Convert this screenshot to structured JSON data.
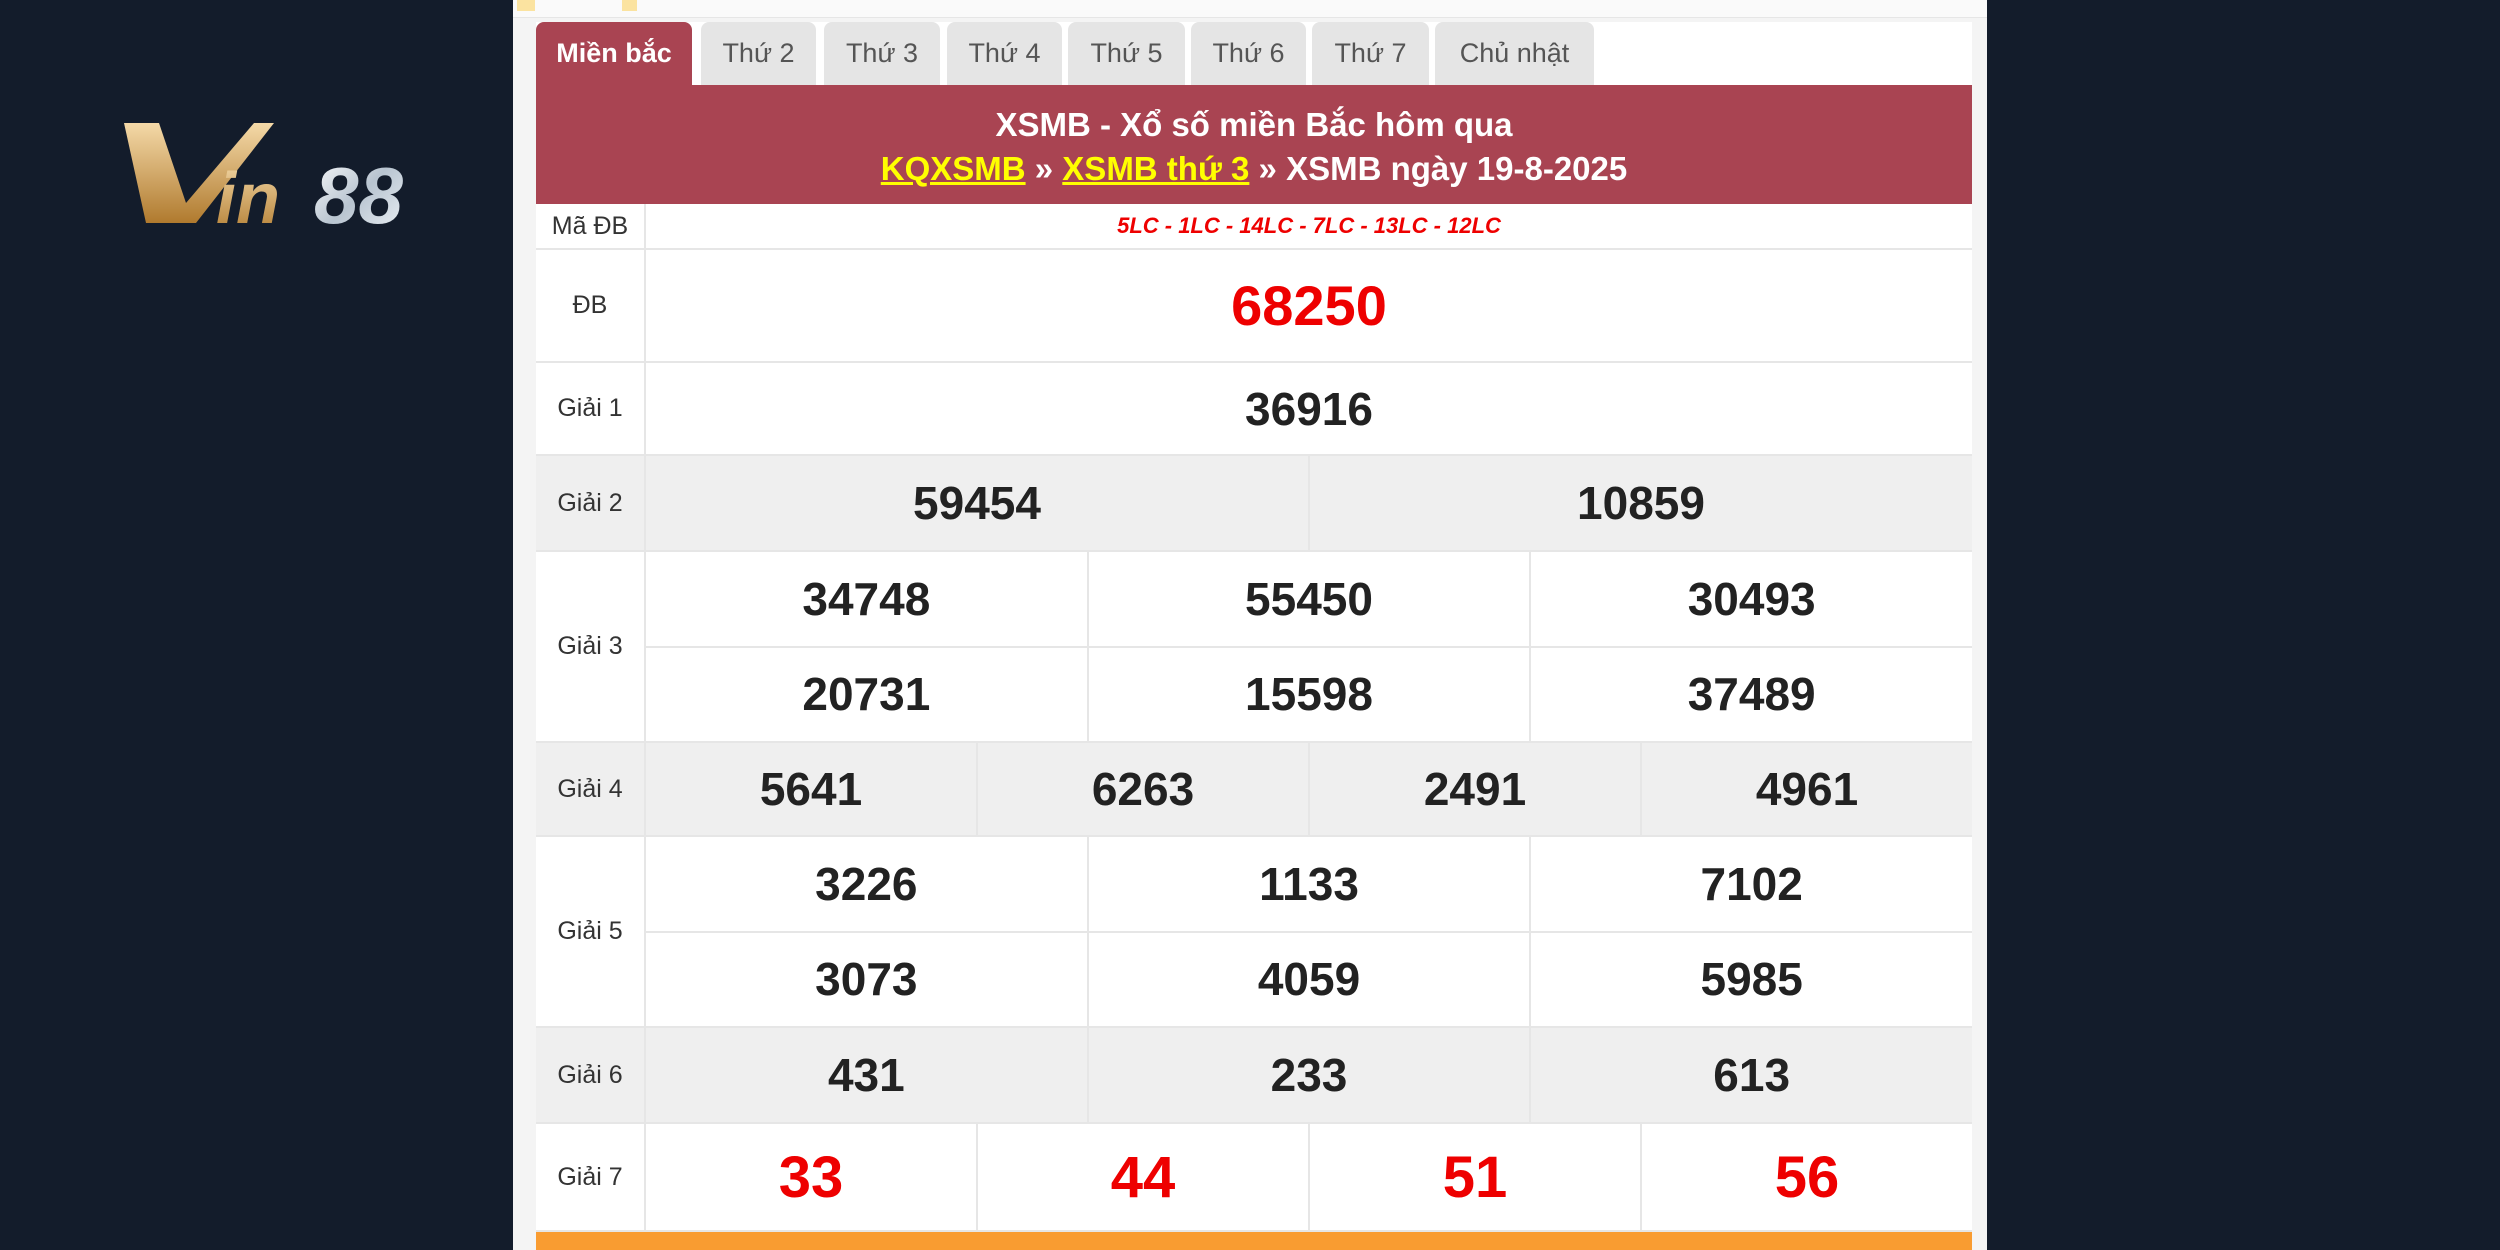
{
  "logo": {
    "text": "Vin88"
  },
  "tabs": [
    "Miền bắc",
    "Thứ 2",
    "Thứ 3",
    "Thứ 4",
    "Thứ 5",
    "Thứ 6",
    "Thứ 7",
    "Chủ nhật"
  ],
  "header": {
    "title": "XSMB - Xổ số miền Bắc hôm qua",
    "crumb1": "KQXSMB",
    "sep": "»",
    "crumb2": "XSMB thứ 3",
    "crumb3": "XSMB ngày 19-8-2025"
  },
  "ma_db": {
    "label": "Mã ĐB",
    "value": "5LC - 1LC - 14LC - 7LC - 13LC - 12LC"
  },
  "prizes": {
    "db": {
      "label": "ĐB",
      "values": [
        "68250"
      ]
    },
    "g1": {
      "label": "Giải 1",
      "values": [
        "36916"
      ]
    },
    "g2": {
      "label": "Giải 2",
      "values": [
        "59454",
        "10859"
      ]
    },
    "g3": {
      "label": "Giải 3",
      "values": [
        "34748",
        "55450",
        "30493",
        "20731",
        "15598",
        "37489"
      ]
    },
    "g4": {
      "label": "Giải 4",
      "values": [
        "5641",
        "6263",
        "2491",
        "4961"
      ]
    },
    "g5": {
      "label": "Giải 5",
      "values": [
        "3226",
        "1133",
        "7102",
        "3073",
        "4059",
        "5985"
      ]
    },
    "g6": {
      "label": "Giải 6",
      "values": [
        "431",
        "233",
        "613"
      ]
    },
    "g7": {
      "label": "Giải 7",
      "values": [
        "33",
        "44",
        "51",
        "56"
      ]
    }
  },
  "colors": {
    "background": "#131c2b",
    "header": "#a94452",
    "accent_red": "#e00000",
    "orange": "#f99c31"
  }
}
